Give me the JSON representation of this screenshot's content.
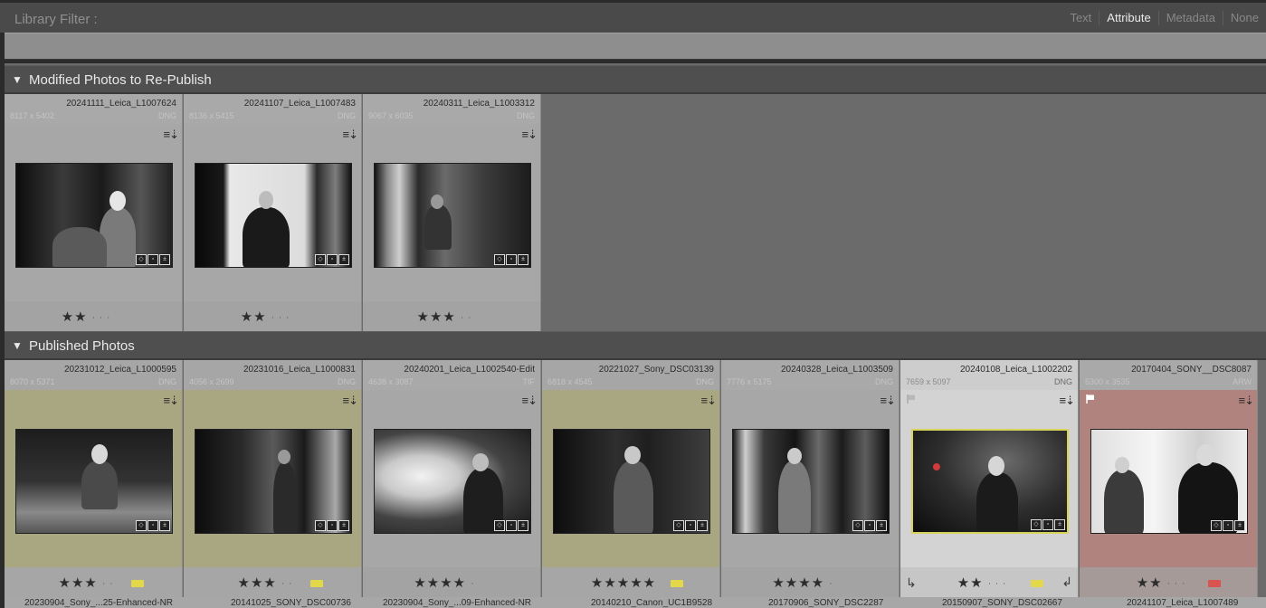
{
  "filter_bar": {
    "label": "Library Filter :",
    "tabs": [
      "Text",
      "Attribute",
      "Metadata",
      "None"
    ],
    "active_tab": "Attribute"
  },
  "sections": [
    {
      "title": "Modified Photos to Re-Publish",
      "cells": [
        {
          "filename": "20241111_Leica_L1007624",
          "dims": "8117 x 5402",
          "ext": "DNG",
          "stars": "★★",
          "dots": "· · ·"
        },
        {
          "filename": "20241107_Leica_L1007483",
          "dims": "8136 x 5415",
          "ext": "DNG",
          "stars": "★★",
          "dots": "· · ·"
        },
        {
          "filename": "20240311_Leica_L1003312",
          "dims": "9067 x 6035",
          "ext": "DNG",
          "stars": "★★★",
          "dots": "· ·"
        }
      ]
    },
    {
      "title": "Published Photos",
      "cells": [
        {
          "filename": "20231012_Leica_L1000595",
          "dims": "8070 x 5371",
          "ext": "DNG",
          "stars": "★★★",
          "dots": "· ·",
          "label_color": "#e3d84a"
        },
        {
          "filename": "20231016_Leica_L1000831",
          "dims": "4056 x 2699",
          "ext": "DNG",
          "stars": "★★★",
          "dots": "· ·",
          "label_color": "#e3d84a"
        },
        {
          "filename": "20240201_Leica_L1002540-Edit",
          "dims": "4638 x 3087",
          "ext": "TIF",
          "stars": "★★★★",
          "dots": "·"
        },
        {
          "filename": "20221027_Sony_DSC03139",
          "dims": "6818 x 4545",
          "ext": "DNG",
          "stars": "★★★★★",
          "dots": "",
          "label_color": "#e3d84a"
        },
        {
          "filename": "20240328_Leica_L1003509",
          "dims": "7776 x 5175",
          "ext": "DNG",
          "stars": "★★★★",
          "dots": "·"
        },
        {
          "filename": "20240108_Leica_L1002202",
          "dims": "7659 x 5097",
          "ext": "DNG",
          "stars": "★★",
          "dots": "· · ·",
          "label_color": "#e3d84a"
        },
        {
          "filename": "20170404_SONY__DSC8087",
          "dims": "5300 x 3535",
          "ext": "ARW",
          "stars": "★★",
          "dots": "· · ·",
          "label_color": "#d9534f"
        }
      ]
    }
  ],
  "next_row": [
    "20230904_Sony_...25-Enhanced-NR",
    "20141025_SONY_DSC00736",
    "20230904_Sony_...09-Enhanced-NR",
    "20140210_Canon_UC1B9528",
    "20170906_SONY_DSC2287",
    "20150907_SONY_DSC02667",
    "20241107_Leica_L1007489"
  ],
  "icons": {
    "metadata_sync": "≡⇣",
    "section_toggle": "▼"
  }
}
